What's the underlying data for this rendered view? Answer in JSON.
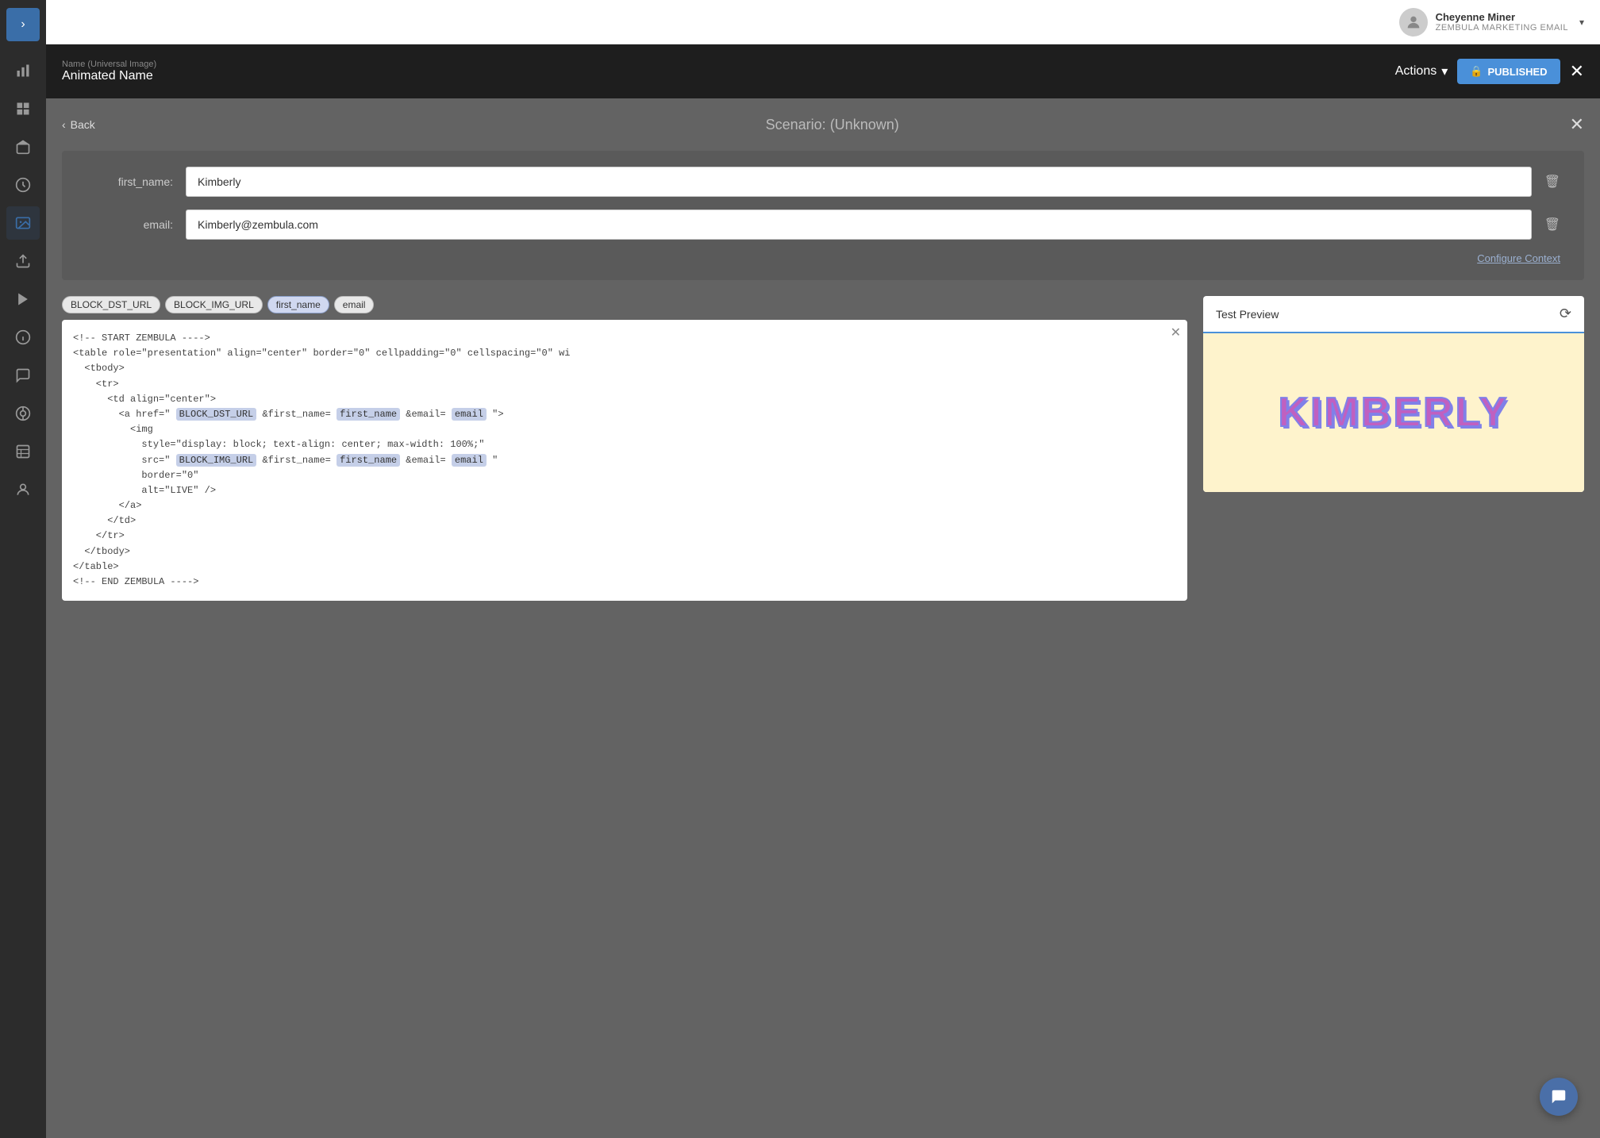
{
  "sidebar": {
    "expand_icon": "›",
    "icons": [
      {
        "name": "bar-chart-icon",
        "symbol": "📊",
        "active": false
      },
      {
        "name": "grid-icon",
        "symbol": "⊞",
        "active": false
      },
      {
        "name": "megaphone-icon",
        "symbol": "📣",
        "active": false
      },
      {
        "name": "lightbulb-icon",
        "symbol": "💡",
        "active": false
      },
      {
        "name": "image-icon",
        "symbol": "🖼",
        "active": true
      },
      {
        "name": "upload-icon",
        "symbol": "⬆",
        "active": false
      },
      {
        "name": "play-icon",
        "symbol": "▶",
        "active": false
      },
      {
        "name": "info-icon",
        "symbol": "ℹ",
        "active": false
      },
      {
        "name": "chat-icon",
        "symbol": "💬",
        "active": false
      },
      {
        "name": "circle-icon",
        "symbol": "◎",
        "active": false
      },
      {
        "name": "table-icon",
        "symbol": "⊟",
        "active": false
      },
      {
        "name": "person-icon",
        "symbol": "👤",
        "active": false
      }
    ]
  },
  "header": {
    "user": {
      "name": "Cheyenne Miner",
      "org": "ZEMBULA MARKETING EMAIL"
    },
    "content_sublabel": "Name (Universal Image)",
    "content_title": "Animated Name",
    "actions_label": "Actions",
    "published_label": "PUBLISHED",
    "close_symbol": "✕"
  },
  "scenario": {
    "title": "Scenario:",
    "subtitle": "(Unknown)",
    "back_label": "Back",
    "close_symbol": "✕",
    "fields": [
      {
        "label": "first_name:",
        "value": "Kimberly",
        "placeholder": "Kimberly",
        "name": "first-name-input"
      },
      {
        "label": "email:",
        "value": "Kimberly@zembula.com",
        "placeholder": "Kimberly@zembula.com",
        "name": "email-input"
      }
    ],
    "configure_link": "Configure Context"
  },
  "tags": [
    {
      "label": "BLOCK_DST_URL",
      "highlight": false
    },
    {
      "label": "BLOCK_IMG_URL",
      "highlight": false
    },
    {
      "label": "first_name",
      "highlight": true
    },
    {
      "label": "email",
      "highlight": false
    }
  ],
  "code": {
    "lines": [
      "<!-- START ZEMBULA ---->",
      "<table role=\"presentation\" align=\"center\" border=\"0\" cellpadding=\"0\" cellspacing=\"0\" wi",
      "  <tbody>",
      "    <tr>",
      "      <td align=\"center\">",
      "        <a href=\" BLOCK_DST_URL &first_name= first_name &email= email \">",
      "          <img",
      "            style=\"display: block; text-align: center; max-width: 100%;\"",
      "            src=\" BLOCK_IMG_URL &first_name= first_name &email= email \"",
      "            border=\"0\"",
      "            alt=\"LIVE\" />",
      "        </a>",
      "      </td>",
      "    </tr>",
      "  </tbody>",
      "</table>",
      "<!-- END ZEMBULA ---->"
    ]
  },
  "preview": {
    "title": "Test Preview",
    "refresh_symbol": "⟳",
    "name_text": "KIMBERLY"
  },
  "chat_button": {
    "symbol": "💬"
  }
}
